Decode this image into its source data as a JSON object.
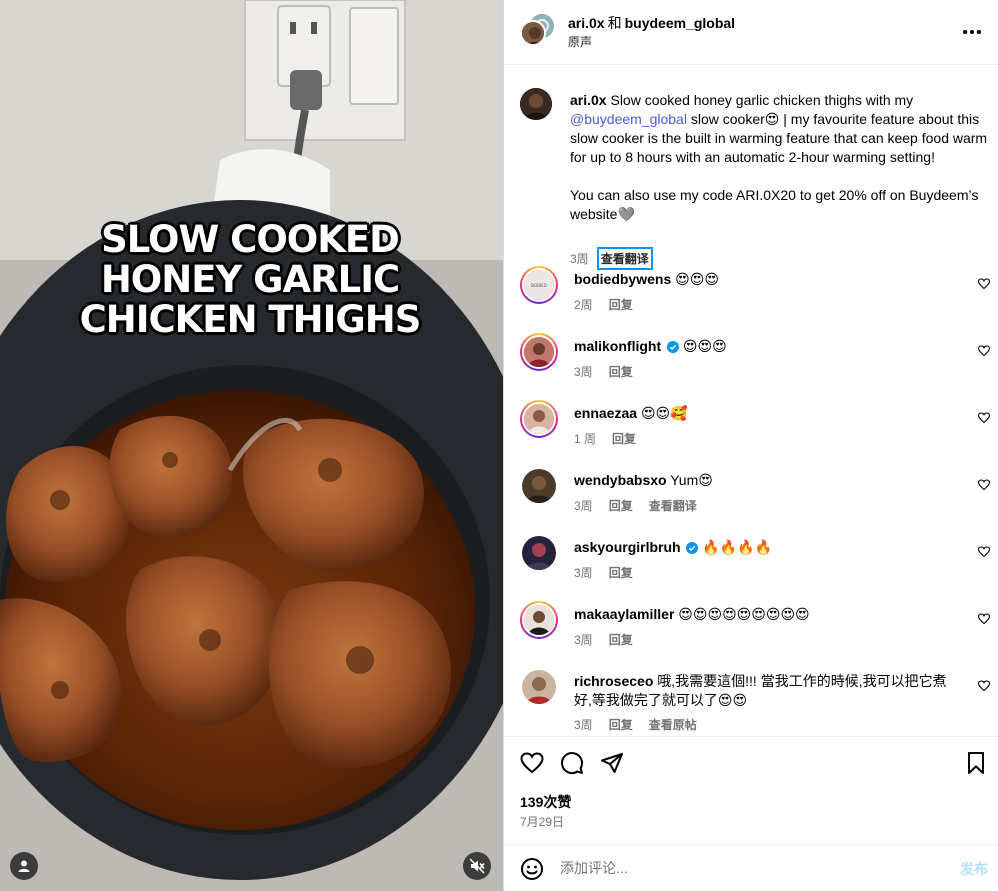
{
  "media": {
    "overlay_lines": [
      "SLOW COOKED",
      "HONEY GARLIC",
      "CHICKEN THIGHS"
    ]
  },
  "header": {
    "user1": "ari.0x",
    "connector": "和",
    "user2": "buydeem_global",
    "audio": "原声"
  },
  "caption": {
    "username": "ari.0x",
    "text_1": "Slow cooked honey garlic chicken thighs with my",
    "mention": "@buydeem_global",
    "text_2": "slow cooker😍 | my favourite feature about this slow cooker is the built in warming feature that can keep food warm for up to 8 hours with an automatic 2-hour warming setting!",
    "text_3": "You can also use my code ARI.0X20 to get 20% off on Buydeem’s website🩶",
    "time": "3周",
    "translate": "查看翻译"
  },
  "comments": [
    {
      "user": "bodiedbywens",
      "text": "😍😍😍",
      "time": "2周",
      "reply": "回复",
      "verified": false,
      "ring": true,
      "avatar_color": "#e9e4df"
    },
    {
      "user": "malikonflight",
      "text": "😍😍😍",
      "time": "3周",
      "reply": "回复",
      "verified": true,
      "ring": true,
      "avatar_color": "#a45c4a"
    },
    {
      "user": "ennaezaa",
      "text": "😍😍🥰",
      "time": "1 周",
      "reply": "回复",
      "verified": false,
      "ring": true,
      "avatar_color": "#c9a08c"
    },
    {
      "user": "wendybabsxo",
      "text": "Yum😍",
      "time": "3周",
      "reply": "回复",
      "extra": "查看翻译",
      "verified": false,
      "ring": false,
      "avatar_color": "#4a3b2a"
    },
    {
      "user": "askyourgirlbruh",
      "text": "🔥🔥🔥🔥",
      "time": "3周",
      "reply": "回复",
      "verified": true,
      "ring": false,
      "avatar_color": "#2b2b3b"
    },
    {
      "user": "makaaylamiller",
      "text": "😍😍😍😍😍😍😍😍😍",
      "time": "3周",
      "reply": "回复",
      "verified": false,
      "ring": true,
      "avatar_color": "#d8cfc8"
    },
    {
      "user": "richroseceo",
      "text": "哦,我需要這個!!! 當我工作的時候,我可以把它煮好,等我做完了就可以了😍😍",
      "time": "3周",
      "reply": "回复",
      "extra": "查看原帖",
      "verified": false,
      "ring": false,
      "avatar_color": "#b9a08a"
    }
  ],
  "footer": {
    "likes": "139次赞",
    "date": "7月29日",
    "comment_placeholder": "添加评论...",
    "post_label": "发布"
  },
  "icons": {
    "like": "heart-icon",
    "comment": "comment-icon",
    "share": "share-icon",
    "save": "bookmark-icon",
    "emoji": "emoji-icon",
    "more": "more-icon",
    "audio": "mute-icon",
    "tag": "user-icon"
  },
  "colors": {
    "link": "#4f5bd5",
    "verified": "#0095f6",
    "muted_text": "#737373",
    "post_disabled": "#b2dffc"
  }
}
